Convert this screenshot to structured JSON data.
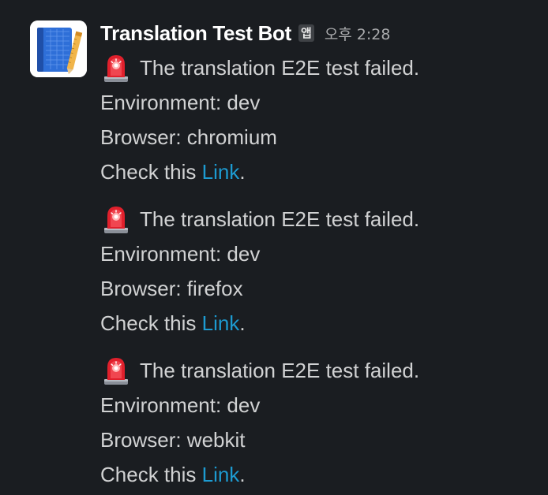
{
  "bot": {
    "name": "Translation Test Bot",
    "badge": "앱",
    "timestamp": "오후 2:28"
  },
  "messages": [
    {
      "icon": "police-car-light-icon",
      "headline": "The translation E2E test failed.",
      "environment": "Environment: dev",
      "browser": "Browser: chromium",
      "check_prefix": "Check this ",
      "link_label": "Link",
      "check_suffix": "."
    },
    {
      "icon": "police-car-light-icon",
      "headline": "The translation E2E test failed.",
      "environment": "Environment: dev",
      "browser": "Browser: firefox",
      "check_prefix": "Check this ",
      "link_label": "Link",
      "check_suffix": "."
    },
    {
      "icon": "police-car-light-icon",
      "headline": "The translation E2E test failed.",
      "environment": "Environment: dev",
      "browser": "Browser: webkit",
      "check_prefix": "Check this ",
      "link_label": "Link",
      "check_suffix": "."
    }
  ],
  "colors": {
    "background": "#1a1d21",
    "text": "#d1d2d3",
    "link": "#1d9bd1",
    "name": "#ffffff"
  }
}
